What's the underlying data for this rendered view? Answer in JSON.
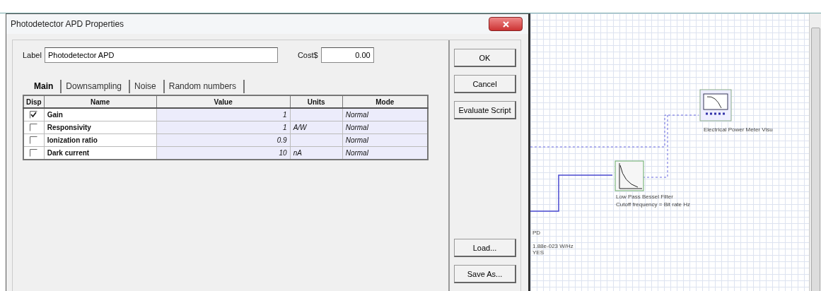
{
  "dialog": {
    "title": "Photodetector APD Properties",
    "label_caption": "Label",
    "label_value": "Photodetector APD",
    "cost_caption": "Cost$",
    "cost_value": "0.00",
    "tabs": [
      {
        "label": "Main",
        "selected": true
      },
      {
        "label": "Downsampling",
        "selected": false
      },
      {
        "label": "Noise",
        "selected": false
      },
      {
        "label": "Random numbers",
        "selected": false
      }
    ],
    "table": {
      "columns": [
        "Disp",
        "Name",
        "Value",
        "Units",
        "Mode"
      ],
      "rows": [
        {
          "checked": true,
          "name": "Gain",
          "value": "1",
          "units": "",
          "mode": "Normal"
        },
        {
          "checked": false,
          "name": "Responsivity",
          "value": "1",
          "units": "A/W",
          "mode": "Normal"
        },
        {
          "checked": false,
          "name": "Ionization ratio",
          "value": "0.9",
          "units": "",
          "mode": "Normal"
        },
        {
          "checked": false,
          "name": "Dark current",
          "value": "10",
          "units": "nA",
          "mode": "Normal"
        }
      ]
    },
    "buttons_top": [
      "OK",
      "Cancel",
      "Evaluate Script"
    ],
    "buttons_bottom": [
      "Load...",
      "Save As..."
    ]
  },
  "canvas": {
    "meter_label": "Electrical Power Meter Visu",
    "filter_label": "Low Pass Bessel Filter",
    "filter_param": "Cutoff frequency =  Bit rate  Hz",
    "pd_lines": [
      "PD",
      "1.88e-023  W/Hz",
      "YES"
    ]
  }
}
